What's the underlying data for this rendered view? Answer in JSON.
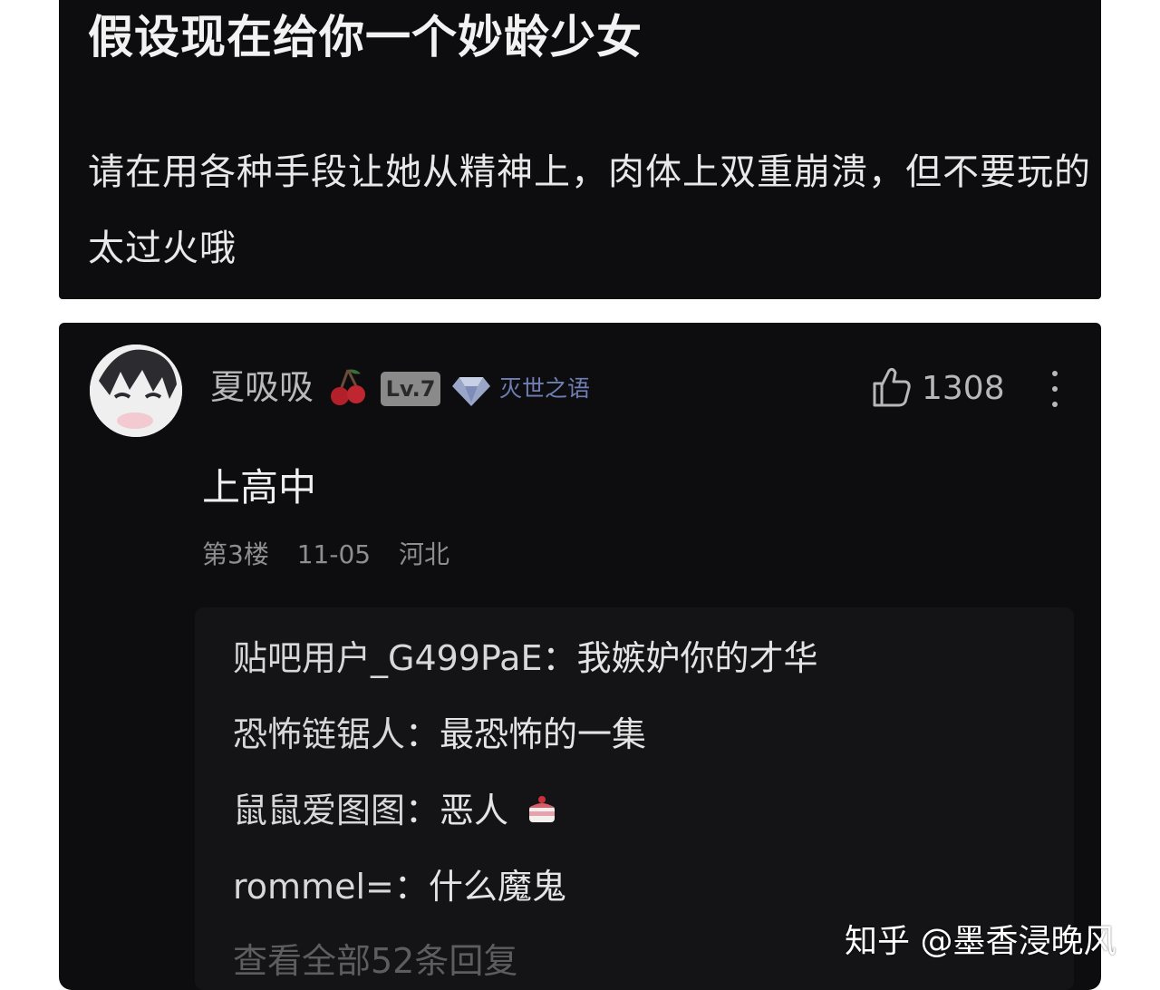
{
  "post": {
    "title": "假设现在给你一个妙龄少女",
    "body": "请在用各种手段让她从精神上，肉体上双重崩溃，但不要玩的太过火哦"
  },
  "comment": {
    "username": "夏吸吸",
    "level": "Lv.7",
    "title_badge": "灭世之语",
    "likes": "1308",
    "text": "上高中",
    "floor": "第3楼",
    "date": "11-05",
    "location": "河北",
    "replies": [
      {
        "author": "贴吧用户_G499PaE",
        "separator": "：",
        "text": "我嫉妒你的才华"
      },
      {
        "author": "恐怖链锯人",
        "separator": "：",
        "text": "最恐怖的一集"
      },
      {
        "author": "鼠鼠爱图图",
        "separator": "：",
        "text": "恶人"
      },
      {
        "author": "rommel=",
        "separator": "：",
        "text": "什么魔鬼"
      }
    ],
    "view_all": "查看全部52条回复"
  },
  "watermark": "知乎 @墨香浸晚风",
  "colors": {
    "panel_bg": "#0d0d0f",
    "reply_bg": "#141416",
    "title_badge": "#6f7fb4",
    "cherry": "#b3202a"
  },
  "icons": {
    "cherry": "cherry-icon",
    "diamond": "diamond-icon",
    "like": "thumbs-up-icon",
    "more": "more-vertical-icon",
    "cake": "cake-emoji-icon"
  }
}
